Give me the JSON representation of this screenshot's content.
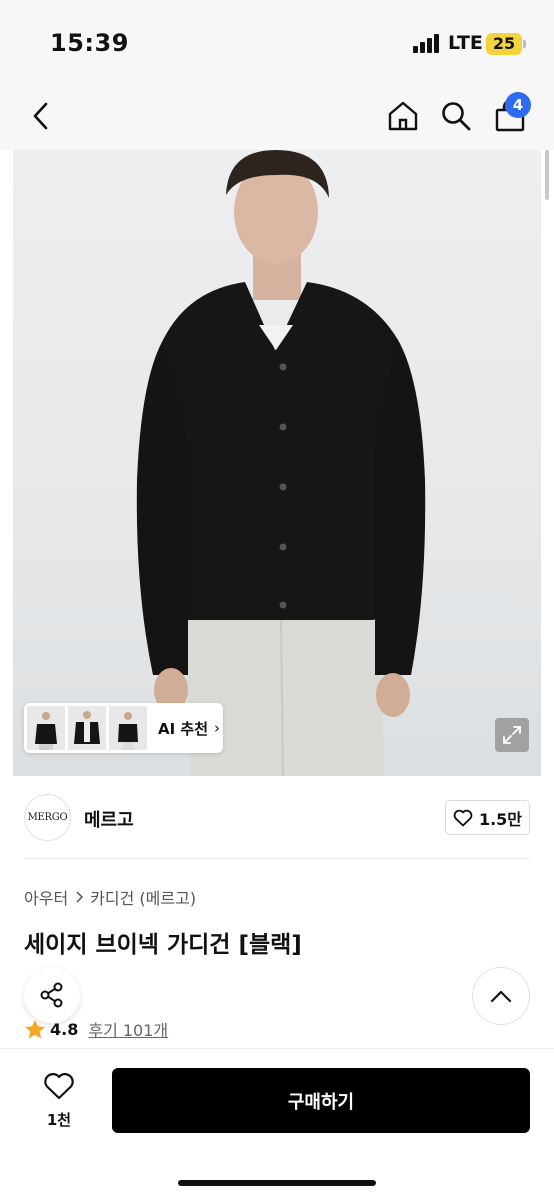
{
  "status_bar": {
    "time": "15:39",
    "network": "LTE",
    "battery": "25"
  },
  "nav": {
    "back_icon": "chevron-left-icon",
    "home_icon": "home-icon",
    "search_icon": "search-icon",
    "cart_icon": "shopping-bag-icon",
    "cart_count": "4"
  },
  "gallery": {
    "ai_label": "AI 추천",
    "ai_chevron": "›",
    "expand_icon": "expand-icon"
  },
  "brand": {
    "logo_text": "MERGO",
    "name": "메르고",
    "like_count": "1.5만"
  },
  "product": {
    "breadcrumb": [
      "아우터",
      "카디건 (메르고)"
    ],
    "title": "세이지 브이넥 가디건 [블랙]",
    "rating": "4.8",
    "reviews": "후기 101개"
  },
  "bottom": {
    "wish_count": "1천",
    "buy_label": "구매하기"
  },
  "colors": {
    "accent_blue": "#2f6bf0",
    "buy_bg": "#000000",
    "star": "#f5a623"
  }
}
